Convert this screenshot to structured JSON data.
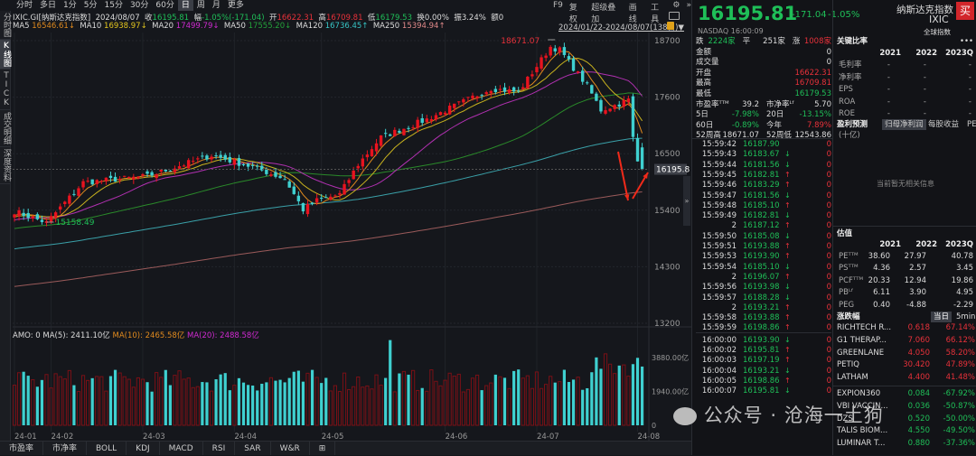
{
  "period_tabs": [
    "分时",
    "多日",
    "1分",
    "5分",
    "15分",
    "30分",
    "60分",
    "日",
    "周",
    "月",
    "更多"
  ],
  "period_selected": "日",
  "side_tabs": [
    "分时图",
    "K线图",
    "TICK",
    "成交明细",
    "深度资料"
  ],
  "side_selected": "K线图",
  "info": {
    "name": "IXIC.GI[纳斯达克指数]",
    "date": "2024/08/07",
    "close_label": "收",
    "close": "16195.81",
    "chg_label": "幅",
    "chg": "-1.05%(-171.04)",
    "open_label": "开",
    "open": "16622.31",
    "high_label": "高",
    "high": "16709.81",
    "low_label": "低",
    "low": "16179.53",
    "turnover": "换0.00%",
    "amplitude": "振3.24%",
    "amount": "额0"
  },
  "ma": {
    "ma5_label": "MA5",
    "ma5": "16546.61↓",
    "ma10_label": "MA10",
    "ma10": "16938.97↓",
    "ma20_label": "MA20",
    "ma20": "17499.79↓",
    "ma50_label": "MA50",
    "ma50": "17555.20↓",
    "ma120_label": "MA120",
    "ma120": "16736.45↑",
    "ma250_label": "MA250",
    "ma250": "15394.94↑"
  },
  "tools": [
    "F9",
    "复权",
    "超级叠加",
    "画线",
    "工具",
    "⚙",
    "»"
  ],
  "date_range": "2024/01/22-2024/08/07(138日)▼",
  "colors": {
    "up": "#e8131f",
    "down": "#3fd0d0",
    "ma5": "#e08a1e",
    "ma10": "#c8b21e",
    "ma20": "#b030b0",
    "ma50": "#2a8a2a",
    "ma120": "#3aa0a8",
    "ma250": "#9a5a5a"
  },
  "chart_data": {
    "type": "candlestick",
    "days": 138,
    "close_keypoints": [
      [
        0,
        15379
      ],
      [
        7,
        15158
      ],
      [
        15,
        15940
      ],
      [
        29,
        16060
      ],
      [
        43,
        16470
      ],
      [
        52,
        16240
      ],
      [
        59,
        16010
      ],
      [
        63,
        15410
      ],
      [
        66,
        15590
      ],
      [
        71,
        15710
      ],
      [
        75,
        16290
      ],
      [
        80,
        16820
      ],
      [
        90,
        17170
      ],
      [
        104,
        17770
      ],
      [
        110,
        17700
      ],
      [
        117,
        18580
      ],
      [
        119,
        18520
      ],
      [
        122,
        18170
      ],
      [
        125,
        17820
      ],
      [
        128,
        17350
      ],
      [
        132,
        17470
      ],
      [
        134,
        17550
      ],
      [
        135,
        16800
      ],
      [
        136,
        16350
      ]
    ],
    "last_candle": {
      "open": 16622.31,
      "high": 16709.81,
      "low": 16179.53,
      "close": 16195.81
    },
    "y_ticks": [
      "18700",
      "17600",
      "16500",
      "15400",
      "14300",
      "13200"
    ],
    "ylim": [
      13200,
      18700
    ],
    "current_price_tag": "16195.8",
    "high_annotation": "18671.07",
    "low_annotation": "15158.49",
    "x_ticks": [
      [
        "24-01",
        0
      ],
      [
        "24-02",
        8
      ],
      [
        "24-03",
        28
      ],
      [
        "24-04",
        48
      ],
      [
        "24-05",
        67
      ],
      [
        "24-06",
        94
      ],
      [
        "24-07",
        114
      ],
      [
        "24-08",
        136
      ]
    ],
    "volume": {
      "label": "AMO: 0",
      "ma5": "MA(5): 2411.10亿",
      "ma10": "MA(10): 2465.58亿",
      "ma20": "MA(20): 2488.58亿",
      "y_ticks": [
        "3880.00亿",
        "1940.00亿",
        "0"
      ],
      "ylim": [
        0,
        3880
      ]
    }
  },
  "bottom_tabs": [
    "市盈率",
    "市净率",
    "BOLL",
    "KDJ",
    "MACD",
    "RSI",
    "SAR",
    "W&R",
    "⊞"
  ],
  "quote": {
    "price": "16195.81",
    "change": "-171.04",
    "pct": "-1.05%",
    "name": "纳斯达克指数",
    "code": "IXIC",
    "buy": "买",
    "exchange": "NASDAQ",
    "time": "16:00:09",
    "category": "全球指数"
  },
  "stats": [
    {
      "l": "跌",
      "v": "2224家",
      "l2": "平",
      "v2": "251家",
      "l3": "涨",
      "v3": "1008家"
    },
    {
      "l": "金额",
      "v": "0"
    },
    {
      "l": "成交量",
      "v": "0"
    },
    {
      "l": "开盘",
      "v": "16622.31",
      "c": "r"
    },
    {
      "l": "最高",
      "v": "16709.81",
      "c": "r"
    },
    {
      "l": "最低",
      "v": "16179.53",
      "c": "g"
    },
    {
      "l": "市盈率ᵀᵀᴹ",
      "v": "39.2",
      "l2": "市净率ᴸᶠ",
      "v2": "5.70"
    },
    {
      "l": "5日",
      "v": "-7.98%",
      "c": "g",
      "l2": "20日",
      "v2": "-13.15%",
      "c2": "g"
    },
    {
      "l": "60日",
      "v": "-0.89%",
      "c": "g",
      "l2": "今年",
      "v2": "7.89%",
      "c2": "r"
    },
    {
      "l": "52周高",
      "v": "18671.07",
      "l2": "52周低",
      "v2": "12543.86"
    }
  ],
  "ticks": [
    [
      "15:59:42",
      "16187.90",
      ""
    ],
    [
      "15:59:43",
      "16183.67",
      "↓"
    ],
    [
      "15:59:44",
      "16181.56",
      "↓"
    ],
    [
      "15:59:45",
      "16182.81",
      "↑"
    ],
    [
      "15:59:46",
      "16183.29",
      "↑"
    ],
    [
      "15:59:47",
      "16181.56",
      "↓"
    ],
    [
      "15:59:48",
      "16185.10",
      "↑"
    ],
    [
      "15:59:49",
      "16182.81",
      "↓"
    ],
    [
      "2",
      "16187.12",
      "↑"
    ],
    [
      "15:59:50",
      "16185.08",
      "↓"
    ],
    [
      "15:59:51",
      "16193.88",
      "↑"
    ],
    [
      "15:59:53",
      "16193.90",
      "↑"
    ],
    [
      "15:59:54",
      "16185.10",
      "↓"
    ],
    [
      "2",
      "16196.07",
      "↑"
    ],
    [
      "15:59:56",
      "16193.98",
      "↓"
    ],
    [
      "15:59:57",
      "16188.28",
      "↓"
    ],
    [
      "2",
      "16193.21",
      "↑"
    ],
    [
      "15:59:58",
      "16193.88",
      "↑"
    ],
    [
      "15:59:59",
      "16198.86",
      "↑"
    ],
    [
      "16:00:00",
      "16193.90",
      "↓"
    ],
    [
      "16:00:02",
      "16195.81",
      "↑"
    ],
    [
      "16:00:03",
      "16197.19",
      "↑"
    ],
    [
      "16:00:04",
      "16193.21",
      "↓"
    ],
    [
      "16:00:05",
      "16198.86",
      "↑"
    ],
    [
      "16:00:07",
      "16195.81",
      "↓"
    ]
  ],
  "tick_vol": "0",
  "ratios": {
    "title": "关键比率",
    "more": "•••",
    "years": [
      "2021",
      "2022",
      "2023Q"
    ],
    "rows": [
      [
        "毛利率",
        "-",
        "-",
        "-"
      ],
      [
        "净利率",
        "-",
        "-",
        "-"
      ],
      [
        "EPS",
        "-",
        "-",
        "-"
      ],
      [
        "ROA",
        "-",
        "-",
        "-"
      ],
      [
        "ROE",
        "-",
        "-",
        "-"
      ]
    ]
  },
  "forecast": {
    "title": "盈利预测",
    "tabs": [
      "归母净利润",
      "每股收益",
      "PE"
    ],
    "unit": "(十亿)",
    "empty": "当前暂无相关信息"
  },
  "valuation": {
    "title": "估值",
    "years": [
      "2021",
      "2022",
      "2023Q"
    ],
    "rows": [
      [
        "PEᵀᵀᴹ",
        "38.60",
        "27.97",
        "40.78"
      ],
      [
        "PSᵀᵀᴹ",
        "4.36",
        "2.57",
        "3.45"
      ],
      [
        "PCFᵀᵀᴹ",
        "20.33",
        "12.94",
        "19.86"
      ],
      [
        "PBᴸᶠ",
        "6.11",
        "3.90",
        "4.95"
      ],
      [
        "PEG",
        "0.40",
        "-4.88",
        "-2.29"
      ]
    ]
  },
  "movers": {
    "title": "涨跌幅",
    "tabs": [
      "当日",
      "5min"
    ],
    "gainers": [
      [
        "RICHTECH R...",
        "0.618",
        "67.14%"
      ],
      [
        "G1 THERAP...",
        "7.060",
        "66.12%"
      ],
      [
        "GREENLANE",
        "4.050",
        "58.20%"
      ],
      [
        "PETIQ",
        "30.420",
        "47.89%"
      ],
      [
        "LATHAM",
        "4.400",
        "41.48%"
      ]
    ],
    "losers": [
      [
        "EXPION360",
        "0.084",
        "-67.92%"
      ],
      [
        "VBI VACCIN...",
        "0.036",
        "-50.87%"
      ],
      [
        "DZS",
        "0.520",
        "-50.00%"
      ],
      [
        "TALIS BIOM...",
        "4.550",
        "-49.50%"
      ],
      [
        "LUMINAR T...",
        "0.880",
        "-37.36%"
      ]
    ]
  },
  "watermark": "公众号 · 沧海一土狗"
}
